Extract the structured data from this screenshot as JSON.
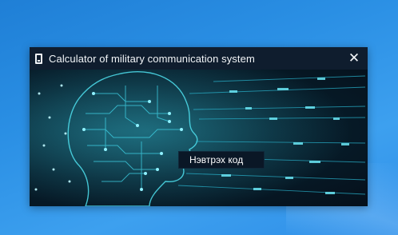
{
  "window": {
    "title": "Calculator of military communication system",
    "close_glyph": "✕",
    "icon": "device-icon"
  },
  "main": {
    "code_label": "Нэвтрэх код"
  },
  "colors": {
    "desktop": "#2a8fe4",
    "titlebar": "#0f1d2e",
    "accent_glow": "#3fd2e6"
  }
}
